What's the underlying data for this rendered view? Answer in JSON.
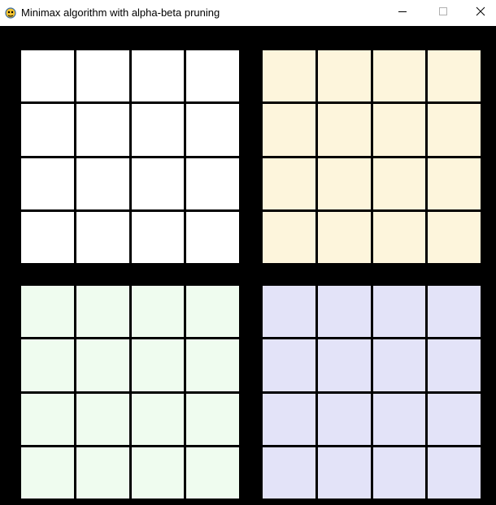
{
  "window": {
    "title": "Minimax algorithm with alpha-beta pruning",
    "app_icon": "pygame-snake-icon",
    "controls": {
      "minimize_icon": "minimize-icon",
      "maximize_icon": "maximize-icon",
      "close_icon": "close-icon"
    }
  },
  "boards": [
    {
      "position": "top-left",
      "cell_color": "#ffffff",
      "rows": 4,
      "cols": 4
    },
    {
      "position": "top-right",
      "cell_color": "#fdf5dc",
      "rows": 4,
      "cols": 4
    },
    {
      "position": "bottom-left",
      "cell_color": "#effcef",
      "rows": 4,
      "cols": 4
    },
    {
      "position": "bottom-right",
      "cell_color": "#e3e3f8",
      "rows": 4,
      "cols": 4
    }
  ],
  "colors": {
    "background": "#000000",
    "grid_lines": "#000000",
    "titlebar": "#ffffff"
  }
}
